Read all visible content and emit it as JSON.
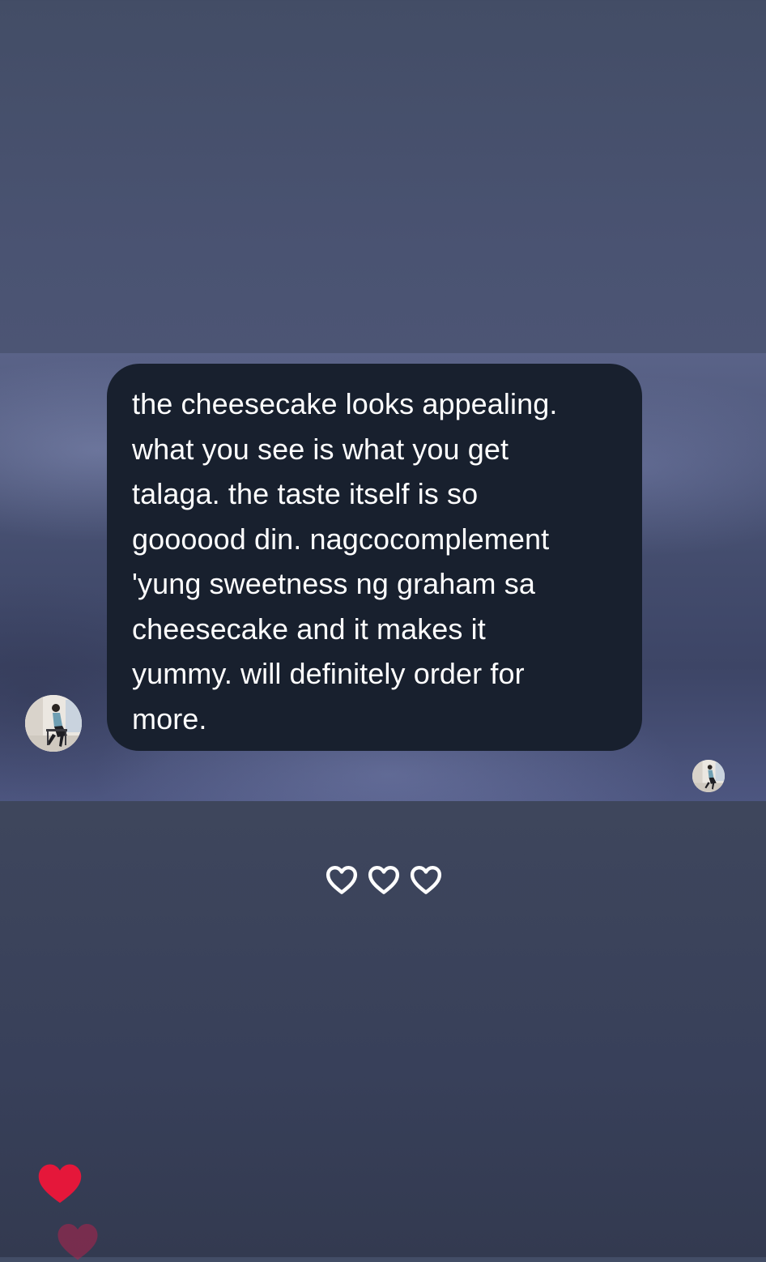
{
  "message": {
    "text": "the cheesecake looks appealing.\nwhat you see is what you get\ntalaga. the taste itself is so\ngoooood din. nagcocomplement\n'yung sweetness ng graham sa\ncheesecake and it makes it\nyummy. will definitely order for\nmore."
  },
  "reactions": {
    "heart_count": 3,
    "icon": "heart-outline-icon",
    "color": "#ffffff"
  },
  "floating_hearts": {
    "icon": "heart-filled-icon",
    "color": "#e5173a",
    "faded_color": "#8a2a4a"
  },
  "colors": {
    "bubble_background": "#18202e",
    "message_text": "#ffffff",
    "background": "#434d66"
  }
}
